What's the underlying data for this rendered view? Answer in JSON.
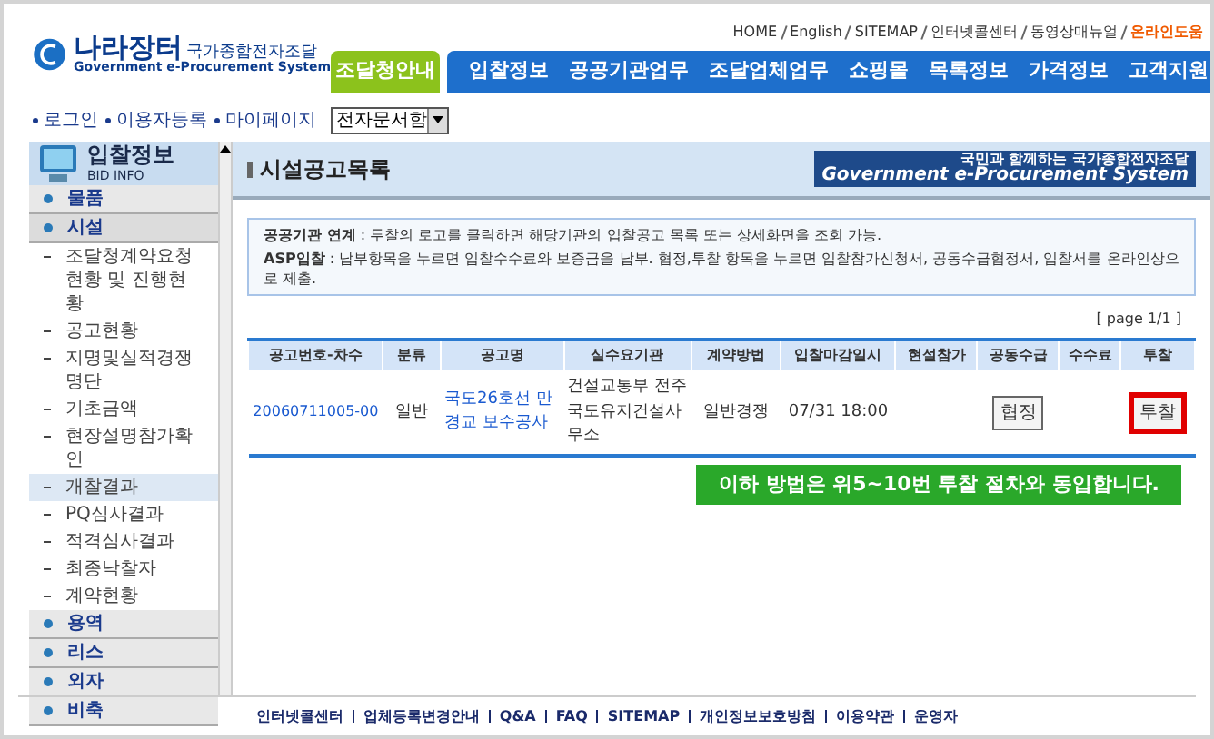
{
  "logo": {
    "name": "나라장터",
    "subtitle": "국가종합전자조달",
    "english": "Government e-Procurement System"
  },
  "top_links": [
    "HOME",
    "English",
    "SITEMAP",
    "인터넷콜센터",
    "동영상매뉴얼",
    "온라인도움"
  ],
  "nav": [
    {
      "label": "조달청안내",
      "kind": "guide",
      "selected": true
    },
    {
      "label": "입찰정보",
      "kind": "menu",
      "selected": false
    },
    {
      "label": "공공기관업무",
      "kind": "menu",
      "selected": false
    },
    {
      "label": "조달업체업무",
      "kind": "menu",
      "selected": false
    },
    {
      "label": "쇼핑몰",
      "kind": "menu",
      "selected": false
    },
    {
      "label": "목록정보",
      "kind": "menu",
      "selected": false
    },
    {
      "label": "가격정보",
      "kind": "menu",
      "selected": false
    },
    {
      "label": "고객지원",
      "kind": "menu",
      "selected": false
    }
  ],
  "user_links": [
    "로그인",
    "이용자등록",
    "마이페이지"
  ],
  "doc_select": {
    "value": "전자문서함"
  },
  "sidebar": {
    "title": "입찰정보",
    "subtitle": "BID INFO",
    "items": [
      {
        "label": "물품",
        "expanded": false
      },
      {
        "label": "시설",
        "expanded": true,
        "children": [
          {
            "label": "조달청계약요청현황 및 진행현황",
            "selected": false
          },
          {
            "label": "공고현황",
            "selected": false
          },
          {
            "label": "지명및실적경쟁명단",
            "selected": false
          },
          {
            "label": "기초금액",
            "selected": false
          },
          {
            "label": "현장설명참가확인",
            "selected": false
          },
          {
            "label": "개찰결과",
            "selected": true
          },
          {
            "label": "PQ심사결과",
            "selected": false
          },
          {
            "label": "적격심사결과",
            "selected": false
          },
          {
            "label": "최종낙찰자",
            "selected": false
          },
          {
            "label": "계약현황",
            "selected": false
          }
        ]
      },
      {
        "label": "용역",
        "expanded": false
      },
      {
        "label": "리스",
        "expanded": false
      },
      {
        "label": "외자",
        "expanded": false
      },
      {
        "label": "비축",
        "expanded": false
      }
    ]
  },
  "banner": {
    "slogan": "국민과 함께하는 국가종합전자조달",
    "english": "Government e-Procurement System"
  },
  "page_title": "시설공고목록",
  "notice": [
    "**공공기관 연계** : 투찰의 로고를 클릭하면 해당기관의 입찰공고 목록 또는 상세화면을 조회 가능.",
    "**ASP입찰** : 납부항목을 누르면 입찰수수료와 보증금을 납부.  협정,투찰 항목을 누르면 입찰참가신청서, 공동수급협정서, 입찰서를 온라인상으로 제출."
  ],
  "pagination": "[ page 1/1 ]",
  "table": {
    "columns": [
      "공고번호-차수",
      "분류",
      "공고명",
      "실수요기관",
      "계약방법",
      "입찰마감일시",
      "현설참가",
      "공동수급",
      "수수료",
      "투찰"
    ],
    "rows": [
      {
        "number": "20060711005-00",
        "category": "일반",
        "title": "국도26호선 만경교 보수공사",
        "agency": "건설교통부 전주국도유지건설사무소",
        "method": "일반경쟁",
        "deadline": "07/31 18:00",
        "joint_button": {
          "label": "협정",
          "highlighted": false
        },
        "bid_button": {
          "label": "투찰",
          "highlighted": true
        }
      }
    ]
  },
  "callout": "이하 방법은 위5~10번 투찰 절차와 동입합니다.",
  "footer_links": [
    "인터넷콜센터",
    "업체등록변경안내",
    "Q&A",
    "FAQ",
    "SITEMAP",
    "개인정보보호방침",
    "이용약관",
    "운영자"
  ]
}
